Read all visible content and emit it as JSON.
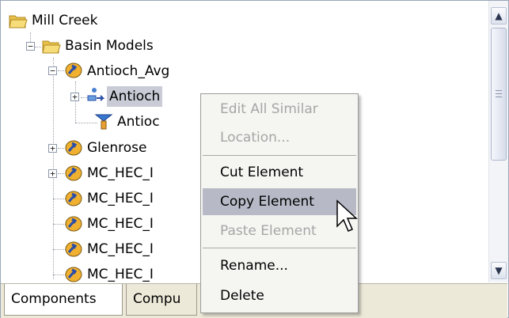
{
  "tree": {
    "nodes": [
      {
        "label": "Mill Creek"
      },
      {
        "label": "Basin Models"
      },
      {
        "label": "Antioch_Avg"
      },
      {
        "label": "Antioch"
      },
      {
        "label": "Antioc"
      },
      {
        "label": "Glenrose"
      },
      {
        "label": "MC_HEC_I"
      },
      {
        "label": "MC_HEC_I"
      },
      {
        "label": "MC_HEC_I"
      },
      {
        "label": "MC_HEC_I"
      },
      {
        "label": "MC_HEC_I"
      }
    ]
  },
  "tabs": [
    {
      "label": "Components"
    },
    {
      "label": "Compu"
    }
  ],
  "context_menu": {
    "items": [
      {
        "label": "Edit All Similar",
        "enabled": false
      },
      {
        "label": "Location...",
        "enabled": false
      },
      {
        "label": "Cut Element",
        "enabled": true
      },
      {
        "label": "Copy Element",
        "enabled": true,
        "highlighted": true
      },
      {
        "label": "Paste Element",
        "enabled": false
      },
      {
        "label": "Rename...",
        "enabled": true
      },
      {
        "label": "Delete",
        "enabled": true
      }
    ]
  },
  "colors": {
    "selection": "#c9ccd6",
    "menu_highlight": "#b7bac6",
    "menu_disabled_text": "#a6a6a6"
  }
}
